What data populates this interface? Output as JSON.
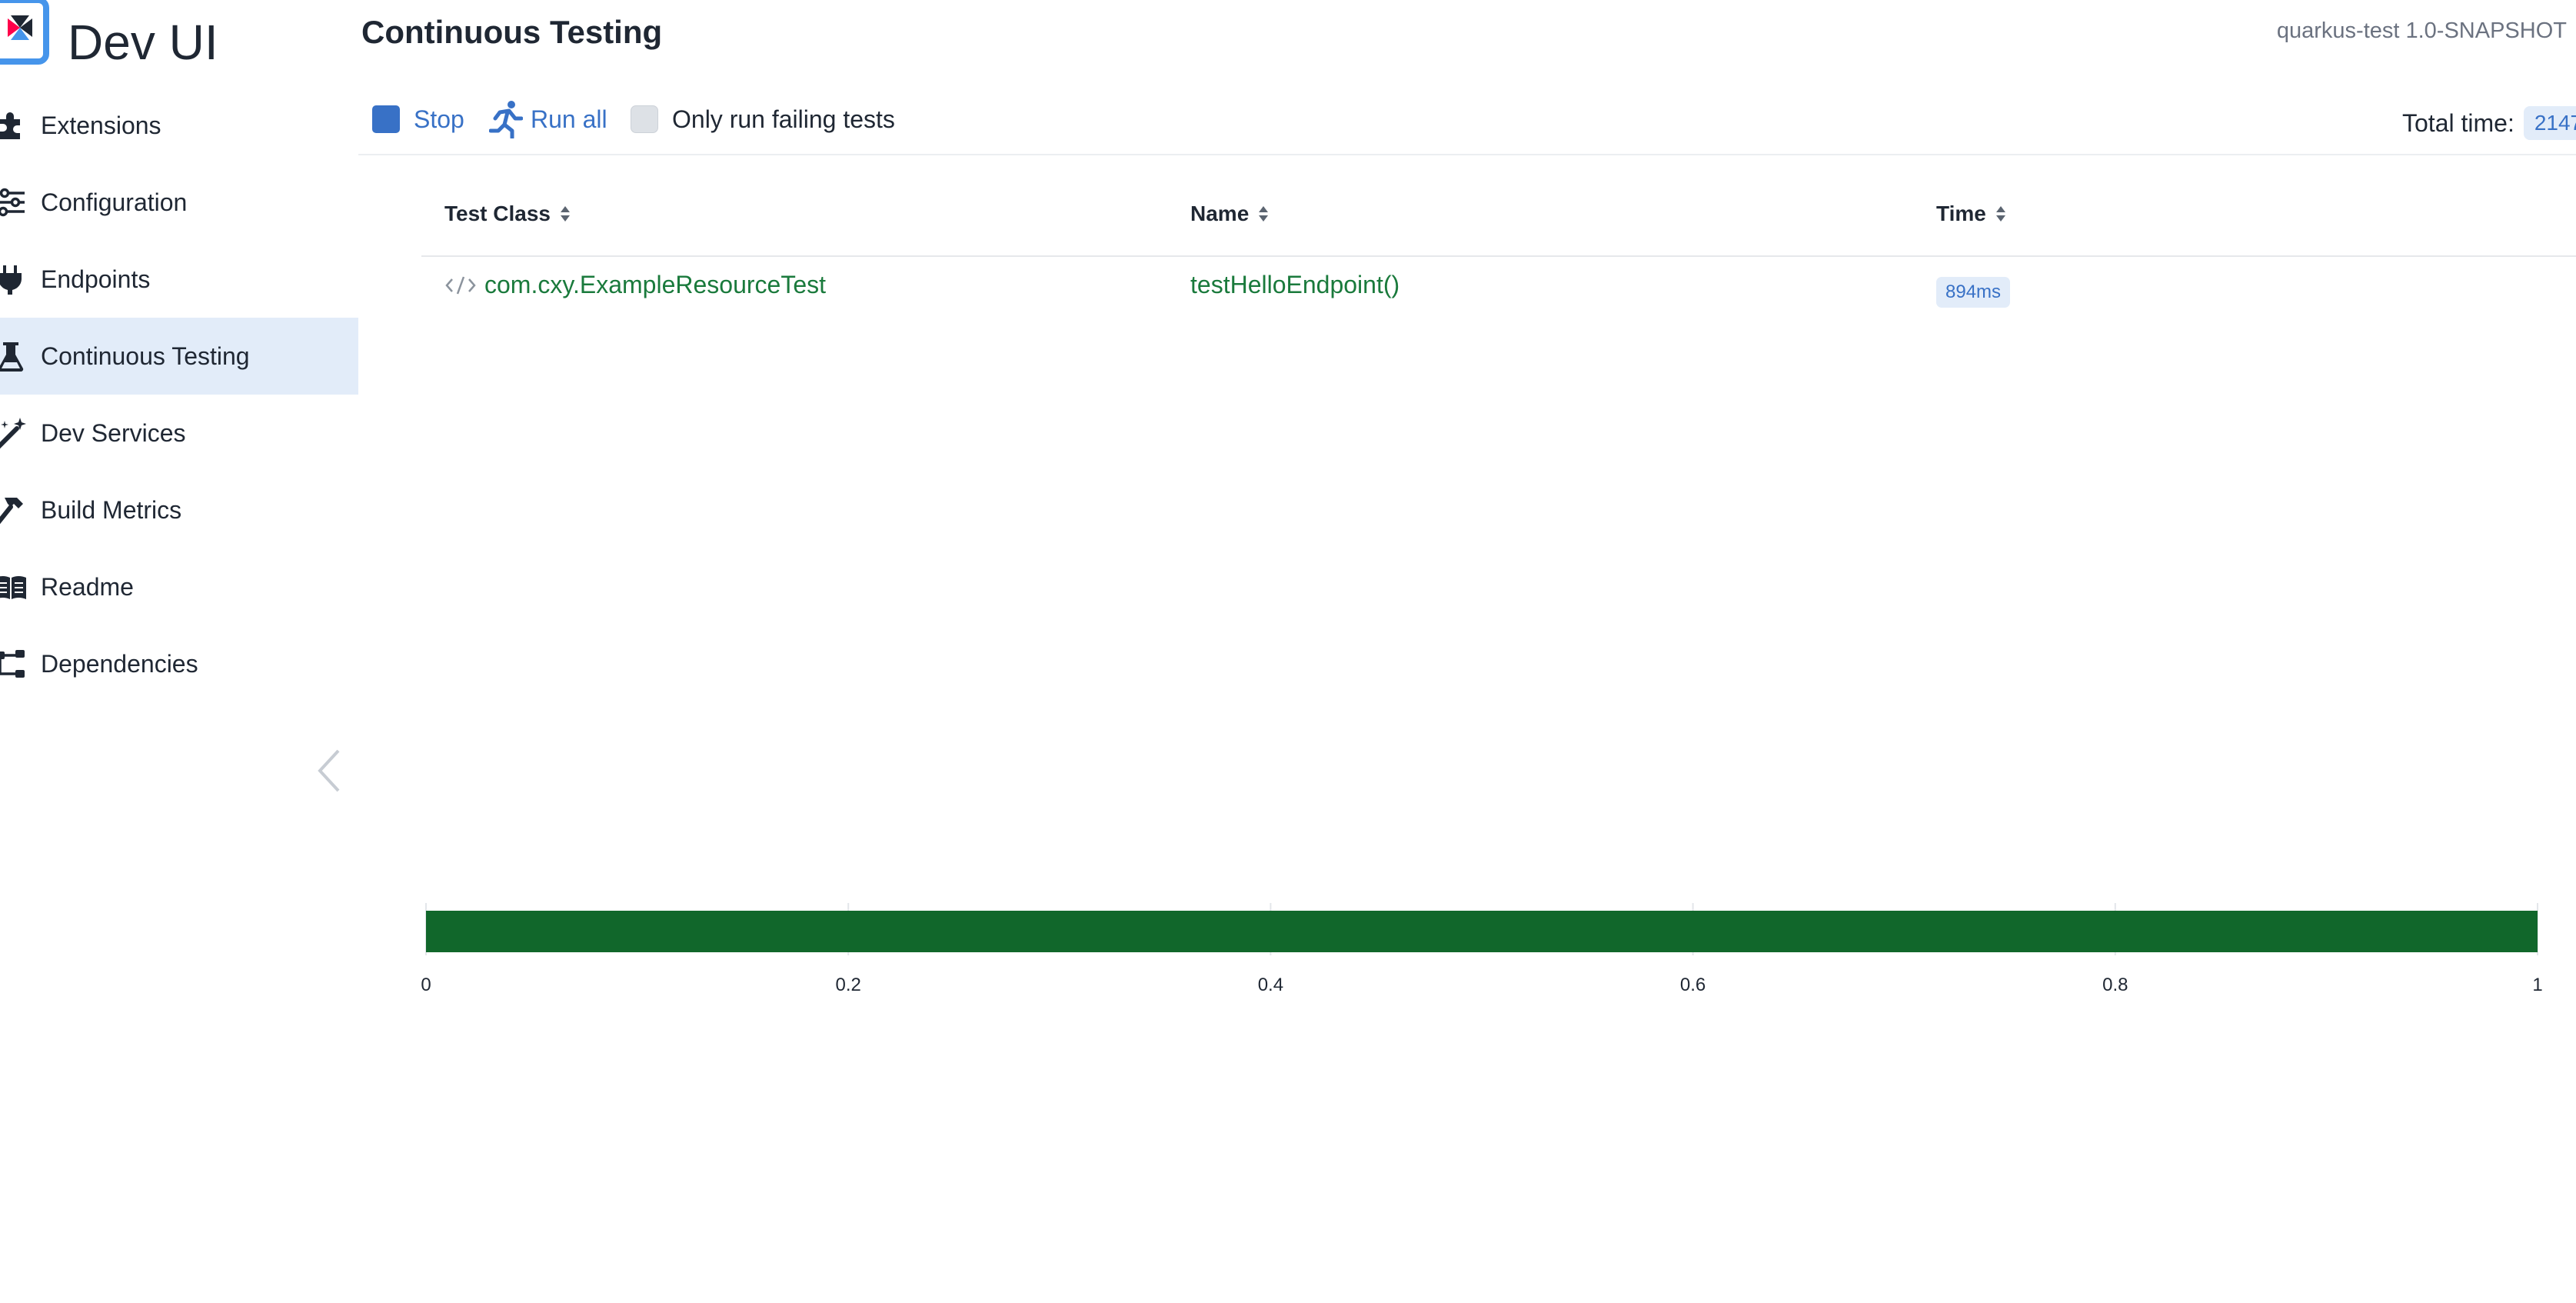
{
  "app": {
    "logo_text": "Dev UI",
    "version": "quarkus-test 1.0-SNAPSHOT"
  },
  "sidebar": {
    "items": [
      {
        "label": "Extensions",
        "icon": "puzzle-icon",
        "active": false
      },
      {
        "label": "Configuration",
        "icon": "sliders-icon",
        "active": false
      },
      {
        "label": "Endpoints",
        "icon": "plug-icon",
        "active": false
      },
      {
        "label": "Continuous Testing",
        "icon": "flask-icon",
        "active": true
      },
      {
        "label": "Dev Services",
        "icon": "wand-icon",
        "active": false
      },
      {
        "label": "Build Metrics",
        "icon": "hammer-icon",
        "active": false
      },
      {
        "label": "Readme",
        "icon": "book-icon",
        "active": false
      },
      {
        "label": "Dependencies",
        "icon": "diagram-icon",
        "active": false
      }
    ]
  },
  "page": {
    "title": "Continuous Testing"
  },
  "toolbar": {
    "stop_label": "Stop",
    "run_all_label": "Run all",
    "only_failing_label": "Only run failing tests",
    "only_failing_checked": false,
    "total_time_label": "Total time:",
    "total_time_value": "2147"
  },
  "table": {
    "columns": [
      "Test Class",
      "Name",
      "Time"
    ],
    "rows": [
      {
        "test_class": "com.cxy.ExampleResourceTest",
        "name": "testHelloEndpoint()",
        "time": "894ms"
      }
    ]
  },
  "colors": {
    "accent": "#3871c6",
    "pass": "#11672b",
    "active_bg": "#e2ecf9"
  },
  "chart_data": {
    "type": "bar",
    "orientation": "horizontal",
    "categories": [
      ""
    ],
    "values": [
      1
    ],
    "xlim": [
      0,
      1
    ],
    "xticks": [
      "0",
      "0.2",
      "0.4",
      "0.6",
      "0.8",
      "1"
    ],
    "grid": true,
    "color": "#11672b"
  }
}
